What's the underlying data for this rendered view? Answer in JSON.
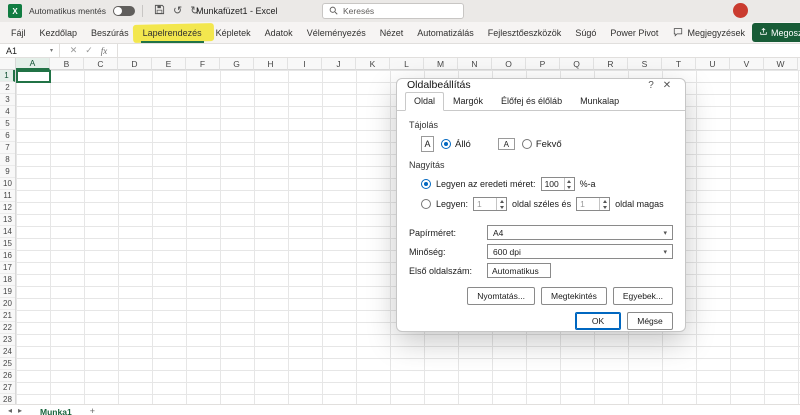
{
  "colors": {
    "excel_green": "#217346",
    "share_green": "#185c37",
    "accent_blue": "#0067c0",
    "highlight_yellow": "#f3e53c",
    "avatar_red": "#ca3b2f"
  },
  "glyphs": {
    "app_icon": "X",
    "undo": "↺",
    "redo": "↻",
    "chevron_down": "▾",
    "help": "?",
    "close": "✕",
    "cancel": "✕",
    "check": "✓",
    "sheet_nav_left": "◂",
    "sheet_nav_right": "▸",
    "add_sheet": "+"
  },
  "titlebar": {
    "autosave_label": "Automatikus mentés",
    "workbook_title": "Munkafüzet1 - Excel",
    "search_placeholder": "Keresés"
  },
  "ribbon": {
    "tabs": [
      "Fájl",
      "Kezdőlap",
      "Beszúrás",
      "Lapelrendezés",
      "Képletek",
      "Adatok",
      "Véleményezés",
      "Nézet",
      "Automatizálás",
      "Fejlesztőeszközök",
      "Súgó",
      "Power Pivot"
    ],
    "highlighted_tab": "Lapelrendezés",
    "comments_label": "Megjegyzések",
    "share_label": "Megosztás"
  },
  "formula_bar": {
    "name_box": "A1",
    "fx_label": "fx"
  },
  "grid": {
    "columns": [
      "A",
      "B",
      "C",
      "D",
      "E",
      "F",
      "G",
      "H",
      "I",
      "J",
      "K",
      "L",
      "M",
      "N",
      "O",
      "P",
      "Q",
      "R",
      "S",
      "T",
      "U",
      "V",
      "W"
    ],
    "row_count": 28,
    "active_cell": "A1"
  },
  "sheet_bar": {
    "sheet_name": "Munka1"
  },
  "dialog": {
    "title": "Oldalbeállítás",
    "tabs": [
      "Oldal",
      "Margók",
      "Élőfej és élőláb",
      "Munkalap"
    ],
    "selected_tab": "Oldal",
    "orientation": {
      "section_label": "Tájolás",
      "icon_glyph": "A",
      "portrait_label": "Álló",
      "landscape_label": "Fekvő",
      "selected": "Álló"
    },
    "scaling": {
      "section_label": "Nagyítás",
      "adjust_label": "Legyen az eredeti méret:",
      "adjust_value": "100",
      "adjust_suffix": "%-a",
      "fit_label": "Legyen:",
      "fit_pages_wide": "1",
      "fit_wide_suffix": "oldal széles és",
      "fit_pages_tall": "1",
      "fit_tall_suffix": "oldal magas",
      "selected": "adjust"
    },
    "paper_size": {
      "label": "Papírméret:",
      "value": "A4"
    },
    "quality": {
      "label": "Minőség:",
      "value": "600 dpi"
    },
    "first_page": {
      "label": "Első oldalszám:",
      "value": "Automatikus"
    },
    "buttons": {
      "print": "Nyomtatás...",
      "preview": "Megtekintés",
      "options": "Egyebek...",
      "ok": "OK",
      "cancel": "Mégse"
    }
  }
}
